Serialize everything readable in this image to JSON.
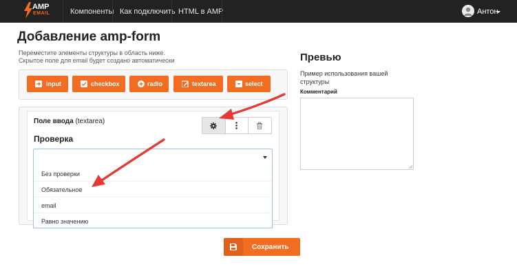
{
  "navbar": {
    "brand": {
      "top": "AMP",
      "bottom": "EMAIL"
    },
    "links": [
      "Компоненты",
      "Как подключить",
      "HTML в AMP"
    ],
    "user": {
      "name": "Антон"
    }
  },
  "page": {
    "title": "Добавление amp-form",
    "hint_line1": "Переместите элементы структуры в область ниже.",
    "hint_line2": "Скрытое поле для email будет создано автоматически"
  },
  "palette": {
    "buttons": [
      {
        "label": "input",
        "icon": "arrow-right-icon"
      },
      {
        "label": "checkbox",
        "icon": "checkbox-icon"
      },
      {
        "label": "radio",
        "icon": "radio-icon"
      },
      {
        "label": "textarea",
        "icon": "edit-icon"
      },
      {
        "label": "select",
        "icon": "select-icon"
      }
    ]
  },
  "field": {
    "title": "Поле ввода",
    "type": "(textarea)",
    "actions": [
      "gear-icon",
      "more-vertical-icon",
      "trash-icon"
    ],
    "validation_label": "Проверка",
    "validation_value": "",
    "options": [
      "Без проверки",
      "Обязательное",
      "email",
      "Равно значению"
    ]
  },
  "save": {
    "label": "Сохранить",
    "icon": "floppy-disk-icon"
  },
  "preview": {
    "title": "Превью",
    "desc_line1": "Пример использования вашей",
    "desc_line2": "структуры",
    "field_label": "Комментарий",
    "textarea_value": ""
  },
  "colors": {
    "accent": "#f26c22",
    "navbar": "#222222",
    "annotation_arrow": "#e53935",
    "select_border": "#9ec3e0"
  }
}
